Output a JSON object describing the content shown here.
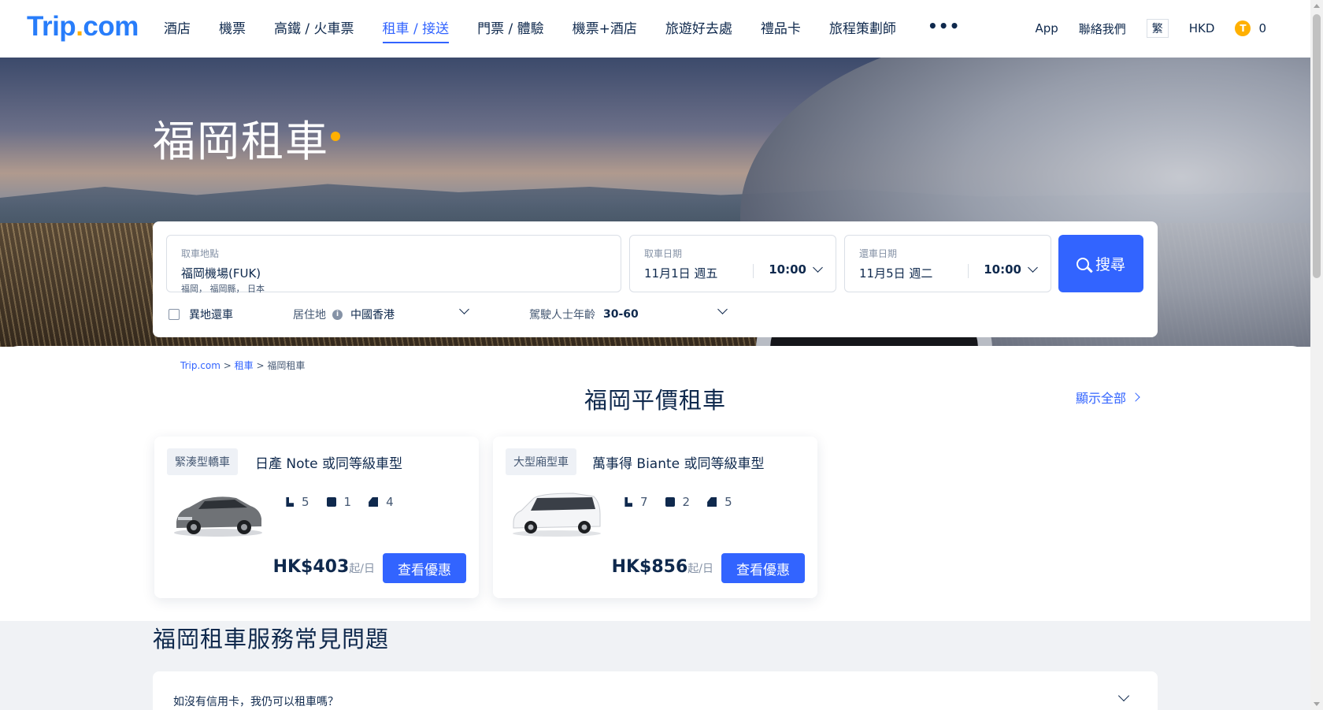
{
  "header": {
    "logo": {
      "main": "Trip",
      "dot": ".",
      "suffix": "com"
    },
    "nav": [
      {
        "label": "酒店"
      },
      {
        "label": "機票"
      },
      {
        "label": "高鐵 / 火車票"
      },
      {
        "label": "租車 / 接送"
      },
      {
        "label": "門票 / 體驗"
      },
      {
        "label": "機票+酒店"
      },
      {
        "label": "旅遊好去處"
      },
      {
        "label": "禮品卡"
      },
      {
        "label": "旅程策劃師"
      }
    ],
    "more": "•••",
    "app": "App",
    "contact": "聯絡我們",
    "language": "繁",
    "currency": "HKD",
    "coin_icon": "T",
    "coins": "0"
  },
  "hero": {
    "title": "福岡租車"
  },
  "search": {
    "location_label": "取車地點",
    "location_value": "福岡機場(FUK)",
    "location_sub": "福岡， 福岡縣， 日本",
    "pickup_label": "取車日期",
    "pickup_date": "11月1日 週五",
    "pickup_time": "10:00",
    "return_label": "還車日期",
    "return_date": "11月5日 週二",
    "return_time": "10:00",
    "search_button": "搜尋",
    "diff_return": "異地還車",
    "residence_label": "居住地",
    "residence_info_icon": "i",
    "residence_value": "中國香港",
    "age_label": "駕駛人士年齡",
    "age_value": "30-60"
  },
  "breadcrumb": {
    "home": "Trip.com",
    "sep": ">",
    "cat": "租車",
    "current": "福岡租車"
  },
  "deals": {
    "title": "福岡平價租車",
    "show_all": "顯示全部",
    "cards": [
      {
        "tag": "緊湊型轎車",
        "name": "日產 Note 或同等級車型",
        "seats": "5",
        "bags": "1",
        "doors": "4",
        "price": "HK$403",
        "unit": "起/日",
        "button": "查看優惠"
      },
      {
        "tag": "大型廂型車",
        "name": "萬事得 Biante 或同等級車型",
        "seats": "7",
        "bags": "2",
        "doors": "5",
        "price": "HK$856",
        "unit": "起/日",
        "button": "查看優惠"
      }
    ]
  },
  "faq": {
    "title": "福岡租車服務常見問題",
    "items": [
      {
        "question": "如沒有信用卡，我仍可以租車嗎？"
      }
    ]
  },
  "colors": {
    "brand": "#287dfa",
    "accent": "#3264ff",
    "coin": "#ffb000",
    "text": "#0f294d"
  }
}
